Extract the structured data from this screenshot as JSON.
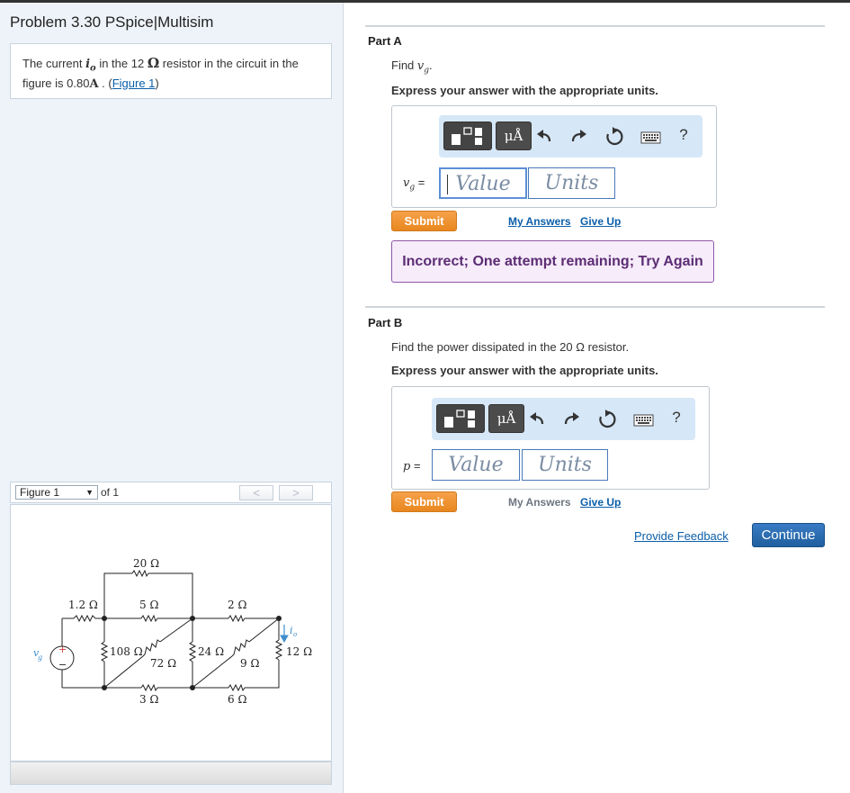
{
  "problem": {
    "title": "Problem 3.30 PSpice|Multisim",
    "text_part1": "The current ",
    "var_current": "i",
    "var_current_sub": "o",
    "text_part2": " in the 12 ",
    "ohm": "Ω",
    "text_part3": " resistor in the circuit in the figure is 0.80",
    "unit_amp": "A",
    "text_part4": " . (",
    "figure_link": "Figure 1",
    "text_part5": ")"
  },
  "figure_nav": {
    "select_value": "Figure 1",
    "of_label": "of 1",
    "prev_label": "<",
    "next_label": ">"
  },
  "circuit": {
    "source_label": "v",
    "source_sub": "g",
    "plus": "+",
    "minus": "−",
    "current_label": "i",
    "current_sub": "o",
    "resistors": [
      "20 Ω",
      "1.2 Ω",
      "5 Ω",
      "2 Ω",
      "108 Ω",
      "72 Ω",
      "24 Ω",
      "9 Ω",
      "12 Ω",
      "3 Ω",
      "6 Ω"
    ]
  },
  "part_a": {
    "title": "Part A",
    "find_prefix": "Find ",
    "find_var": "v",
    "find_sub": "g",
    "find_suffix": ".",
    "instructions": "Express your answer with the appropriate units.",
    "var_label": "v",
    "var_sub": "g",
    "equals": "=",
    "value_placeholder": "Value",
    "units_placeholder": "Units",
    "submit": "Submit",
    "my_answers": "My Answers",
    "give_up": "Give Up",
    "feedback": "Incorrect; One attempt remaining; Try Again"
  },
  "part_b": {
    "title": "Part B",
    "question": "Find the power dissipated in the 20 Ω resistor.",
    "instructions": "Express your answer with the appropriate units.",
    "var_label": "p",
    "equals": "=",
    "value_placeholder": "Value",
    "units_placeholder": "Units",
    "submit": "Submit",
    "my_answers": "My Answers",
    "give_up": "Give Up"
  },
  "toolbar": {
    "units_button": "μÅ",
    "help": "?",
    "icons": [
      "templates-icon",
      "units-icon",
      "undo-icon",
      "redo-icon",
      "reset-icon",
      "keyboard-icon",
      "help-icon"
    ]
  },
  "footer": {
    "provide_feedback": "Provide Feedback",
    "continue": "Continue"
  },
  "colors": {
    "submit": "#e8871f",
    "continue": "#1f5f9f",
    "feedback_bg": "#f6ecfa",
    "feedback_border": "#8e56a8",
    "toolbar_bg": "#d6e7f7",
    "link": "#0b5ea8"
  }
}
